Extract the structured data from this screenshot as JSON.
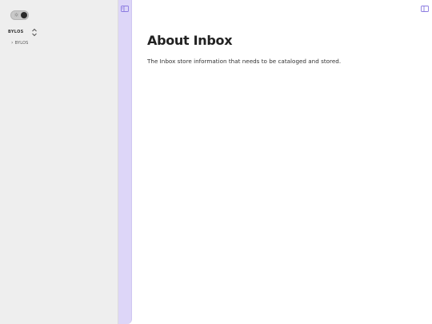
{
  "sidebar": {
    "vault_name": "BYLOS",
    "tree_items": [
      {
        "label": "BYLOS",
        "icon": "chevron-right-icon"
      }
    ],
    "theme_toggle": {
      "state": "dark",
      "icon": "sun-icon"
    }
  },
  "ribbon": {
    "icon": "sidebar-toggle-icon"
  },
  "main": {
    "title": "About Inbox",
    "body": "The Inbox store information that needs to be cataloged and stored.",
    "right_icon": "right-sidebar-toggle-icon"
  },
  "colors": {
    "sidebar_bg": "#eeeeee",
    "ribbon_bg": "#ddd6f8",
    "accent": "#8b7be0",
    "text": "#222222"
  }
}
